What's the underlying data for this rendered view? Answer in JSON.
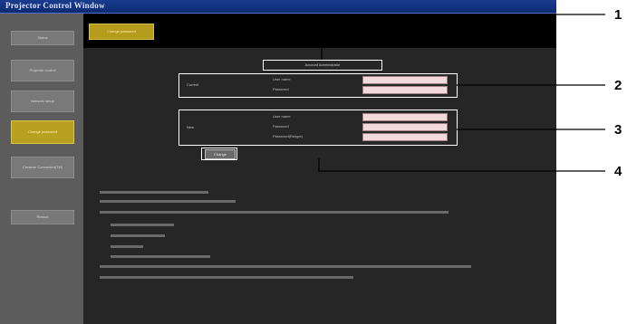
{
  "window": {
    "title": "Projector Control Window"
  },
  "sidebar": {
    "items": [
      {
        "label": "Status"
      },
      {
        "label": "Projector control"
      },
      {
        "label": "Network setup"
      },
      {
        "label": "Change password",
        "active": true
      },
      {
        "label": "Crestron Connected(TM)"
      },
      {
        "label": "Reboot"
      }
    ]
  },
  "toolbar": {
    "change_password_tab": "Change password"
  },
  "form": {
    "header": "Account Administrator",
    "current": {
      "label": "Current",
      "fields": [
        {
          "label": "User name"
        },
        {
          "label": "Password"
        }
      ]
    },
    "new": {
      "label": "New",
      "fields": [
        {
          "label": "User name"
        },
        {
          "label": "Password"
        },
        {
          "label": "Password(Retype)"
        }
      ]
    },
    "change_button": "Change"
  },
  "notes_count": 11,
  "callouts": [
    "1",
    "2",
    "3",
    "4"
  ],
  "colors": {
    "frame": "#ffffff",
    "active_nav": "#b8a020",
    "field_bg": "#f3dada"
  }
}
